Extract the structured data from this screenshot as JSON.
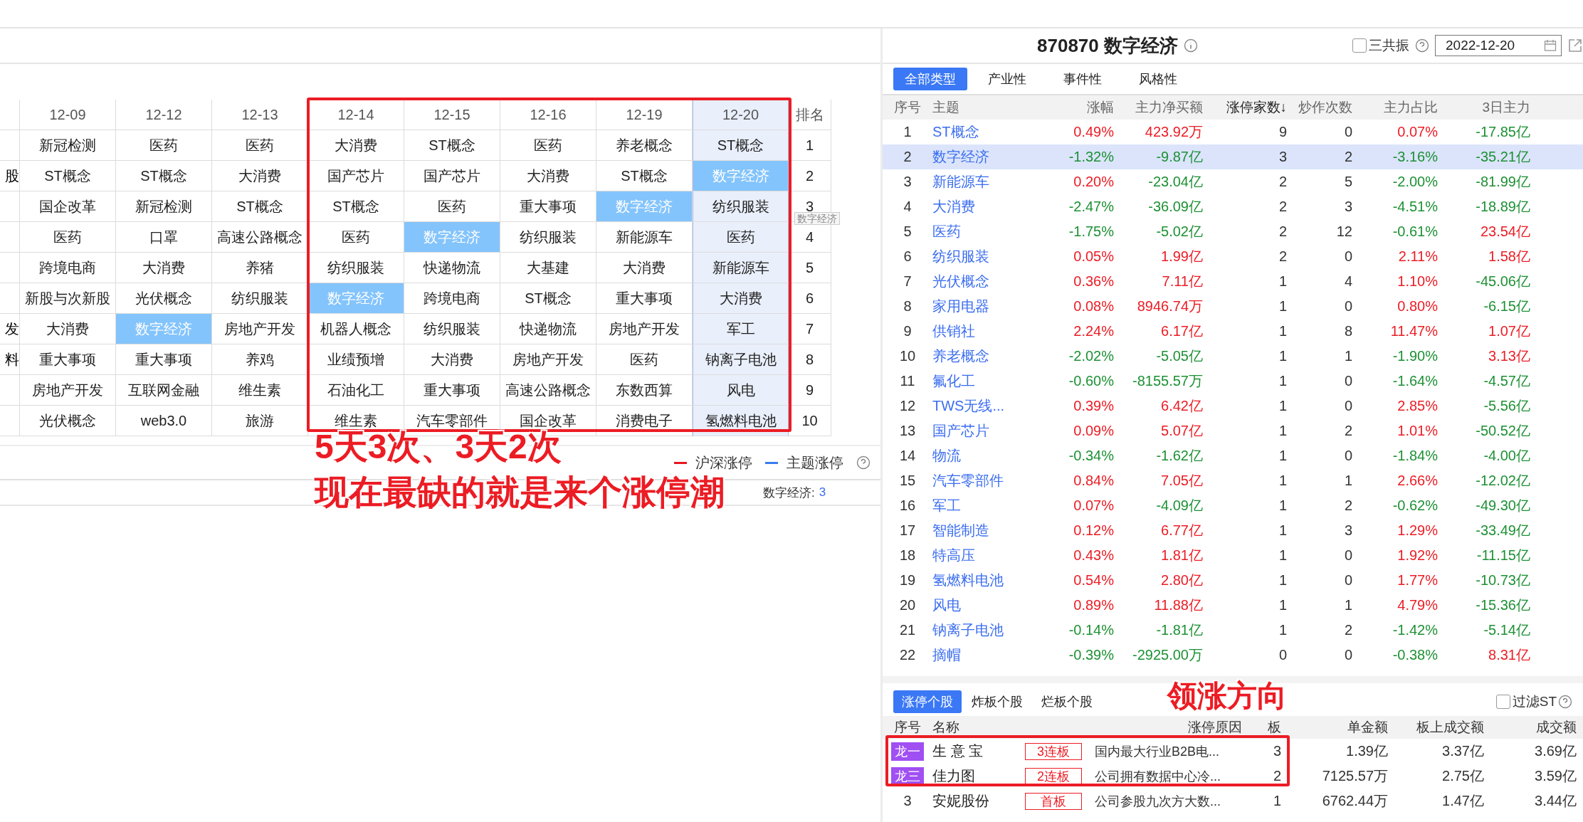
{
  "left_table": {
    "columns": [
      "12-09",
      "12-12",
      "12-13",
      "12-14",
      "12-15",
      "12-16",
      "12-19",
      "12-20"
    ],
    "rank_header": "排名",
    "rows": [
      {
        "cells": [
          {
            "text": "新冠检测",
            "selected": false
          },
          {
            "text": "医药",
            "selected": false
          },
          {
            "text": "医药",
            "selected": false
          },
          {
            "text": "大消费",
            "selected": false
          },
          {
            "text": "ST概念",
            "selected": false
          },
          {
            "text": "医药",
            "selected": false
          },
          {
            "text": "养老概念",
            "selected": false
          },
          {
            "text": "ST概念",
            "selected": false
          }
        ],
        "rank": "1"
      },
      {
        "clipped": "股",
        "cells": [
          {
            "text": "ST概念",
            "selected": false
          },
          {
            "text": "ST概念",
            "selected": false
          },
          {
            "text": "大消费",
            "selected": false
          },
          {
            "text": "国产芯片",
            "selected": false
          },
          {
            "text": "国产芯片",
            "selected": false
          },
          {
            "text": "大消费",
            "selected": false
          },
          {
            "text": "ST概念",
            "selected": false
          },
          {
            "text": "数字经济",
            "selected": true
          }
        ],
        "rank": "2"
      },
      {
        "cells": [
          {
            "text": "国企改革",
            "selected": false
          },
          {
            "text": "新冠检测",
            "selected": false
          },
          {
            "text": "ST概念",
            "selected": false
          },
          {
            "text": "ST概念",
            "selected": false
          },
          {
            "text": "医药",
            "selected": false
          },
          {
            "text": "重大事项",
            "selected": false
          },
          {
            "text": "数字经济",
            "selected": true
          },
          {
            "text": "纺织服装",
            "selected": false
          }
        ],
        "rank": "3"
      },
      {
        "cells": [
          {
            "text": "医药",
            "selected": false
          },
          {
            "text": "口罩",
            "selected": false
          },
          {
            "text": "高速公路概念",
            "selected": false
          },
          {
            "text": "医药",
            "selected": false
          },
          {
            "text": "数字经济",
            "selected": true
          },
          {
            "text": "纺织服装",
            "selected": false
          },
          {
            "text": "新能源车",
            "selected": false
          },
          {
            "text": "医药",
            "selected": false
          }
        ],
        "rank": "4"
      },
      {
        "cells": [
          {
            "text": "跨境电商",
            "selected": false
          },
          {
            "text": "大消费",
            "selected": false
          },
          {
            "text": "养猪",
            "selected": false
          },
          {
            "text": "纺织服装",
            "selected": false
          },
          {
            "text": "快递物流",
            "selected": false
          },
          {
            "text": "大基建",
            "selected": false
          },
          {
            "text": "大消费",
            "selected": false
          },
          {
            "text": "新能源车",
            "selected": false
          }
        ],
        "rank": "5"
      },
      {
        "cells": [
          {
            "text": "新股与次新股",
            "selected": false
          },
          {
            "text": "光伏概念",
            "selected": false
          },
          {
            "text": "纺织服装",
            "selected": false
          },
          {
            "text": "数字经济",
            "selected": true
          },
          {
            "text": "跨境电商",
            "selected": false
          },
          {
            "text": "ST概念",
            "selected": false
          },
          {
            "text": "重大事项",
            "selected": false
          },
          {
            "text": "大消费",
            "selected": false
          }
        ],
        "rank": "6"
      },
      {
        "clipped": "发",
        "cells": [
          {
            "text": "大消费",
            "selected": false
          },
          {
            "text": "数字经济",
            "selected": true
          },
          {
            "text": "房地产开发",
            "selected": false
          },
          {
            "text": "机器人概念",
            "selected": false
          },
          {
            "text": "纺织服装",
            "selected": false
          },
          {
            "text": "快递物流",
            "selected": false
          },
          {
            "text": "房地产开发",
            "selected": false
          },
          {
            "text": "军工",
            "selected": false
          }
        ],
        "rank": "7"
      },
      {
        "clipped": "料",
        "cells": [
          {
            "text": "重大事项",
            "selected": false
          },
          {
            "text": "重大事项",
            "selected": false
          },
          {
            "text": "养鸡",
            "selected": false
          },
          {
            "text": "业绩预增",
            "selected": false
          },
          {
            "text": "大消费",
            "selected": false
          },
          {
            "text": "房地产开发",
            "selected": false
          },
          {
            "text": "医药",
            "selected": false
          },
          {
            "text": "钠离子电池",
            "selected": false
          }
        ],
        "rank": "8"
      },
      {
        "cells": [
          {
            "text": "房地产开发",
            "selected": false
          },
          {
            "text": "互联网金融",
            "selected": false
          },
          {
            "text": "维生素",
            "selected": false
          },
          {
            "text": "石油化工",
            "selected": false
          },
          {
            "text": "重大事项",
            "selected": false
          },
          {
            "text": "高速公路概念",
            "selected": false
          },
          {
            "text": "东数西算",
            "selected": false
          },
          {
            "text": "风电",
            "selected": false
          }
        ],
        "rank": "9"
      },
      {
        "cells": [
          {
            "text": "光伏概念",
            "selected": false
          },
          {
            "text": "web3.0",
            "selected": false
          },
          {
            "text": "旅游",
            "selected": false
          },
          {
            "text": "维生素",
            "selected": false
          },
          {
            "text": "汽车零部件",
            "selected": false
          },
          {
            "text": "国企改革",
            "selected": false
          },
          {
            "text": "消费电子",
            "selected": false
          },
          {
            "text": "氢燃料电池",
            "selected": false
          }
        ],
        "rank": "10"
      }
    ],
    "tooltip": "数字经济"
  },
  "legend": [
    {
      "label": "沪深涨停",
      "color": "#e8141e"
    },
    {
      "label": "主题涨停",
      "color": "#3a7cf0"
    }
  ],
  "theme_count": {
    "label": "数字经济:",
    "value": "3"
  },
  "detail": {
    "title": "870870 数字经济",
    "resonance": {
      "label": "三共振",
      "checked": false
    },
    "date": "2022-12-20",
    "tabs": [
      {
        "label": "全部类型",
        "selected": true
      },
      {
        "label": "产业性",
        "selected": false
      },
      {
        "label": "事件性",
        "selected": false
      },
      {
        "label": "风格性",
        "selected": false
      }
    ],
    "columns": [
      "序号",
      "主题",
      "涨幅",
      "主力净买额",
      "涨停家数↓",
      "炒作次数",
      "主力占比",
      "3日主力"
    ],
    "rows": [
      {
        "no": "1",
        "theme": "ST概念",
        "change": "0.49%",
        "net": "423.92万",
        "limit": "9",
        "times": "0",
        "ratio": "0.07%",
        "three_day": "-17.85亿",
        "selected": false
      },
      {
        "no": "2",
        "theme": "数字经济",
        "change": "-1.32%",
        "net": "-9.87亿",
        "limit": "3",
        "times": "2",
        "ratio": "-3.16%",
        "three_day": "-35.21亿",
        "selected": true
      },
      {
        "no": "3",
        "theme": "新能源车",
        "change": "0.20%",
        "net": "-23.04亿",
        "limit": "2",
        "times": "5",
        "ratio": "-2.00%",
        "three_day": "-81.99亿",
        "selected": false
      },
      {
        "no": "4",
        "theme": "大消费",
        "change": "-2.47%",
        "net": "-36.09亿",
        "limit": "2",
        "times": "3",
        "ratio": "-4.51%",
        "three_day": "-18.89亿",
        "selected": false
      },
      {
        "no": "5",
        "theme": "医药",
        "change": "-1.75%",
        "net": "-5.02亿",
        "limit": "2",
        "times": "12",
        "ratio": "-0.61%",
        "three_day": "23.54亿",
        "selected": false
      },
      {
        "no": "6",
        "theme": "纺织服装",
        "change": "0.05%",
        "net": "1.99亿",
        "limit": "2",
        "times": "0",
        "ratio": "2.11%",
        "three_day": "1.58亿",
        "selected": false
      },
      {
        "no": "7",
        "theme": "光伏概念",
        "change": "0.36%",
        "net": "7.11亿",
        "limit": "1",
        "times": "4",
        "ratio": "1.10%",
        "three_day": "-45.06亿",
        "selected": false
      },
      {
        "no": "8",
        "theme": "家用电器",
        "change": "0.08%",
        "net": "8946.74万",
        "limit": "1",
        "times": "0",
        "ratio": "0.80%",
        "three_day": "-6.15亿",
        "selected": false
      },
      {
        "no": "9",
        "theme": "供销社",
        "change": "2.24%",
        "net": "6.17亿",
        "limit": "1",
        "times": "8",
        "ratio": "11.47%",
        "three_day": "1.07亿",
        "selected": false
      },
      {
        "no": "10",
        "theme": "养老概念",
        "change": "-2.02%",
        "net": "-5.05亿",
        "limit": "1",
        "times": "1",
        "ratio": "-1.90%",
        "three_day": "3.13亿",
        "selected": false
      },
      {
        "no": "11",
        "theme": "氟化工",
        "change": "-0.60%",
        "net": "-8155.57万",
        "limit": "1",
        "times": "0",
        "ratio": "-1.64%",
        "three_day": "-4.57亿",
        "selected": false
      },
      {
        "no": "12",
        "theme": "TWS无线...",
        "change": "0.39%",
        "net": "6.42亿",
        "limit": "1",
        "times": "0",
        "ratio": "2.85%",
        "three_day": "-5.56亿",
        "selected": false
      },
      {
        "no": "13",
        "theme": "国产芯片",
        "change": "0.09%",
        "net": "5.07亿",
        "limit": "1",
        "times": "2",
        "ratio": "1.01%",
        "three_day": "-50.52亿",
        "selected": false
      },
      {
        "no": "14",
        "theme": "物流",
        "change": "-0.34%",
        "net": "-1.62亿",
        "limit": "1",
        "times": "0",
        "ratio": "-1.84%",
        "three_day": "-4.00亿",
        "selected": false
      },
      {
        "no": "15",
        "theme": "汽车零部件",
        "change": "0.84%",
        "net": "7.05亿",
        "limit": "1",
        "times": "1",
        "ratio": "2.66%",
        "three_day": "-12.02亿",
        "selected": false
      },
      {
        "no": "16",
        "theme": "军工",
        "change": "0.07%",
        "net": "-4.09亿",
        "limit": "1",
        "times": "2",
        "ratio": "-0.62%",
        "three_day": "-49.30亿",
        "selected": false
      },
      {
        "no": "17",
        "theme": "智能制造",
        "change": "0.12%",
        "net": "6.77亿",
        "limit": "1",
        "times": "3",
        "ratio": "1.29%",
        "three_day": "-33.49亿",
        "selected": false
      },
      {
        "no": "18",
        "theme": "特高压",
        "change": "0.43%",
        "net": "1.81亿",
        "limit": "1",
        "times": "0",
        "ratio": "1.92%",
        "three_day": "-11.15亿",
        "selected": false
      },
      {
        "no": "19",
        "theme": "氢燃料电池",
        "change": "0.54%",
        "net": "2.80亿",
        "limit": "1",
        "times": "0",
        "ratio": "1.77%",
        "three_day": "-10.73亿",
        "selected": false
      },
      {
        "no": "20",
        "theme": "风电",
        "change": "0.89%",
        "net": "11.88亿",
        "limit": "1",
        "times": "1",
        "ratio": "4.79%",
        "three_day": "-15.36亿",
        "selected": false
      },
      {
        "no": "21",
        "theme": "钠离子电池",
        "change": "-0.14%",
        "net": "-1.81亿",
        "limit": "1",
        "times": "2",
        "ratio": "-1.42%",
        "three_day": "-5.14亿",
        "selected": false
      },
      {
        "no": "22",
        "theme": "摘帽",
        "change": "-0.39%",
        "net": "-2925.00万",
        "limit": "0",
        "times": "0",
        "ratio": "-0.38%",
        "three_day": "8.31亿",
        "selected": false
      }
    ]
  },
  "stocks": {
    "tabs": [
      {
        "label": "涨停个股",
        "selected": true
      },
      {
        "label": "炸板个股",
        "selected": false
      },
      {
        "label": "烂板个股",
        "selected": false
      }
    ],
    "filter": {
      "label": "过滤ST",
      "checked": false
    },
    "columns": [
      "序号",
      "名称",
      "涨停原因",
      "板",
      "单金额",
      "板上成交额",
      "成交额"
    ],
    "rows": [
      {
        "rank": {
          "kind": "badge",
          "text": "龙一"
        },
        "name": "生 意 宝",
        "tag": "3连板",
        "reason": "国内最大行业B2B电...",
        "boards": "3",
        "order": "1.39亿",
        "on_board": "3.37亿",
        "turnover": "3.69亿"
      },
      {
        "rank": {
          "kind": "badge",
          "text": "龙三"
        },
        "name": "佳力图",
        "tag": "2连板",
        "reason": "公司拥有数据中心冷...",
        "boards": "2",
        "order": "7125.57万",
        "on_board": "2.75亿",
        "turnover": "3.59亿"
      },
      {
        "rank": {
          "kind": "number",
          "text": "3"
        },
        "name": "安妮股份",
        "tag": "首板",
        "reason": "公司参股九次方大数...",
        "boards": "1",
        "order": "6762.44万",
        "on_board": "1.47亿",
        "turnover": "3.44亿"
      }
    ]
  },
  "annotations": {
    "notes": [
      "5天3次、3天2次",
      "现在最缺的就是来个涨停潮"
    ],
    "label": "领涨方向"
  }
}
